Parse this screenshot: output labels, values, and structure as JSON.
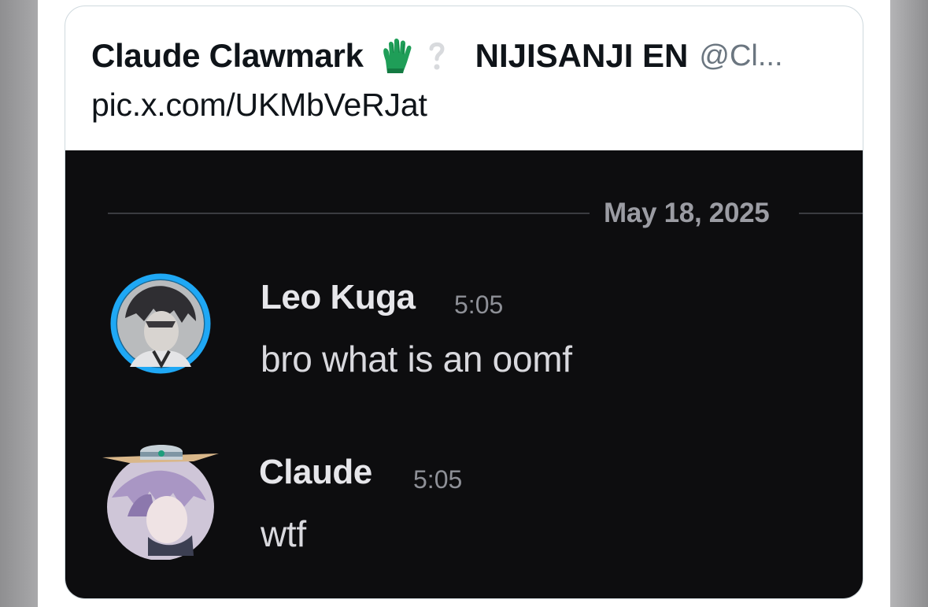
{
  "quoted_post": {
    "display_name": "Claude Clawmark",
    "affiliation": "NIJISANJI EN",
    "handle": "@Cl...",
    "text": "pic.x.com/UKMbVeRJat",
    "icons": [
      "green-glove-emoji-icon",
      "verified-badge-icon"
    ]
  },
  "screenshot": {
    "date_divider": "May 18, 2025",
    "messages": [
      {
        "author": "Leo Kuga",
        "time": "5:05",
        "text": "bro what is an oomf",
        "avatar_icon": "leo-kuga-avatar"
      },
      {
        "author": "Claude",
        "time": "5:05",
        "text": "wtf",
        "avatar_icon": "claude-avatar"
      }
    ]
  },
  "colors": {
    "chat_background": "#0d0d0f",
    "username": "#e6e6ea",
    "timestamp": "#8e9097",
    "avatar_ring": "#1da1f2"
  }
}
